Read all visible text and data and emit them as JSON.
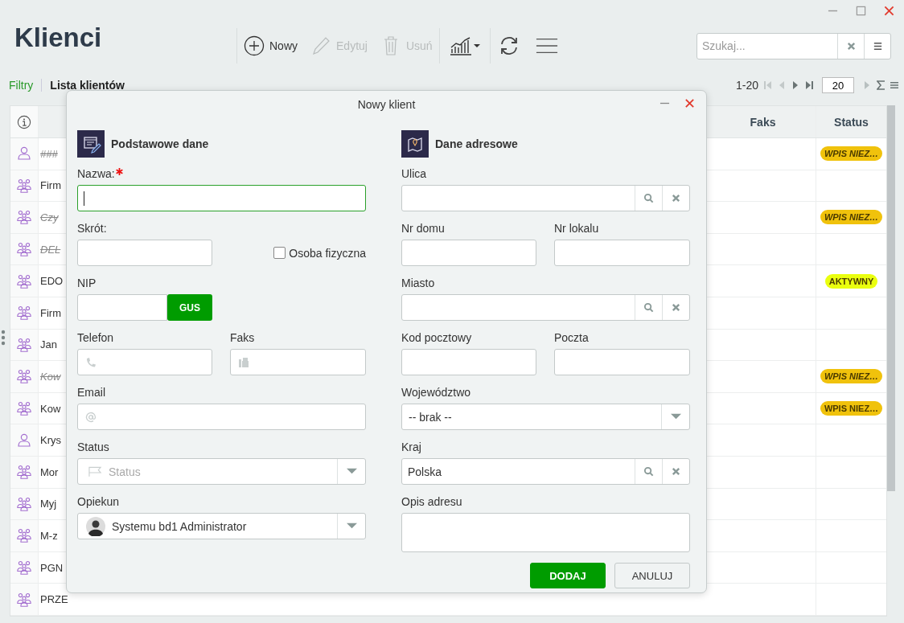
{
  "window": {
    "title": "Klienci"
  },
  "toolbar": [
    {
      "kind": "add",
      "label": "Nowy",
      "disabled": false
    },
    {
      "kind": "edit",
      "label": "Edytuj",
      "disabled": true
    },
    {
      "kind": "delete",
      "label": "Usuń",
      "disabled": true
    },
    {
      "kind": "chart"
    },
    {
      "kind": "refresh"
    },
    {
      "kind": "menu"
    }
  ],
  "search": {
    "placeholder": "Szukaj..."
  },
  "tabs": [
    {
      "label": "Filtry",
      "selected": false
    },
    {
      "label": "Lista klientów",
      "selected": true
    }
  ],
  "pagination": {
    "range": "1-20",
    "page_size": "20"
  },
  "table": {
    "columns": [
      "Faks",
      "Status"
    ],
    "rows": [
      {
        "kind": "person",
        "name": "###",
        "struck": true,
        "status": {
          "label": "WPIS NIEZ…",
          "color": "#f0c20c"
        }
      },
      {
        "kind": "group",
        "name": "Firm",
        "struck": false
      },
      {
        "kind": "group",
        "name": "Czy",
        "struck": true,
        "status": {
          "label": "WPIS NIEZ…",
          "color": "#f0c20c"
        }
      },
      {
        "kind": "group",
        "name": "DEL",
        "struck": true
      },
      {
        "kind": "group",
        "name": "EDO",
        "struck": false,
        "status": {
          "label": "AKTYWNY",
          "color": "#eaff0f"
        }
      },
      {
        "kind": "group",
        "name": "Firm",
        "struck": false
      },
      {
        "kind": "group",
        "name": "Jan",
        "struck": false
      },
      {
        "kind": "group",
        "name": "Kow",
        "struck": true,
        "status": {
          "label": "WPIS NIEZ…",
          "color": "#f0c20c"
        }
      },
      {
        "kind": "group",
        "name": "Kow",
        "struck": false,
        "status": {
          "label": "WPIS NIEZ…",
          "color": "#f0c20c"
        }
      },
      {
        "kind": "person",
        "name": "Krys",
        "struck": false
      },
      {
        "kind": "group",
        "name": "Mor",
        "struck": false
      },
      {
        "kind": "group",
        "name": "Myj",
        "struck": false
      },
      {
        "kind": "group",
        "name": "M-z",
        "struck": false
      },
      {
        "kind": "group",
        "name": "PGN",
        "struck": false
      },
      {
        "kind": "group",
        "name": "PRZE",
        "struck": false
      }
    ]
  },
  "dialog": {
    "title": "Nowy klient",
    "basic": {
      "heading": "Podstawowe dane",
      "name_label": "Nazwa:",
      "name_required": true,
      "name_focused": true,
      "short_label": "Skrót:",
      "person_checkbox": {
        "label": "Osoba fizyczna",
        "checked": false
      },
      "nip_label": "NIP",
      "gus_button": "GUS",
      "phone_label": "Telefon",
      "fax_label": "Faks",
      "email_label": "Email",
      "status_label": "Status",
      "status_placeholder": "Status",
      "guardian_label": "Opiekun",
      "guardian_value": "Systemu bd1 Administrator"
    },
    "address": {
      "heading": "Dane adresowe",
      "street_label": "Ulica",
      "house_label": "Nr domu",
      "flat_label": "Nr lokalu",
      "city_label": "Miasto",
      "postal_label": "Kod pocztowy",
      "post_label": "Poczta",
      "province_label": "Województwo",
      "province_value": "-- brak --",
      "country_label": "Kraj",
      "country_value": "Polska",
      "note_label": "Opis adresu"
    },
    "buttons": [
      {
        "kind": "primary",
        "label": "DODAJ"
      },
      {
        "kind": "secondary",
        "label": "ANULUJ"
      }
    ]
  }
}
